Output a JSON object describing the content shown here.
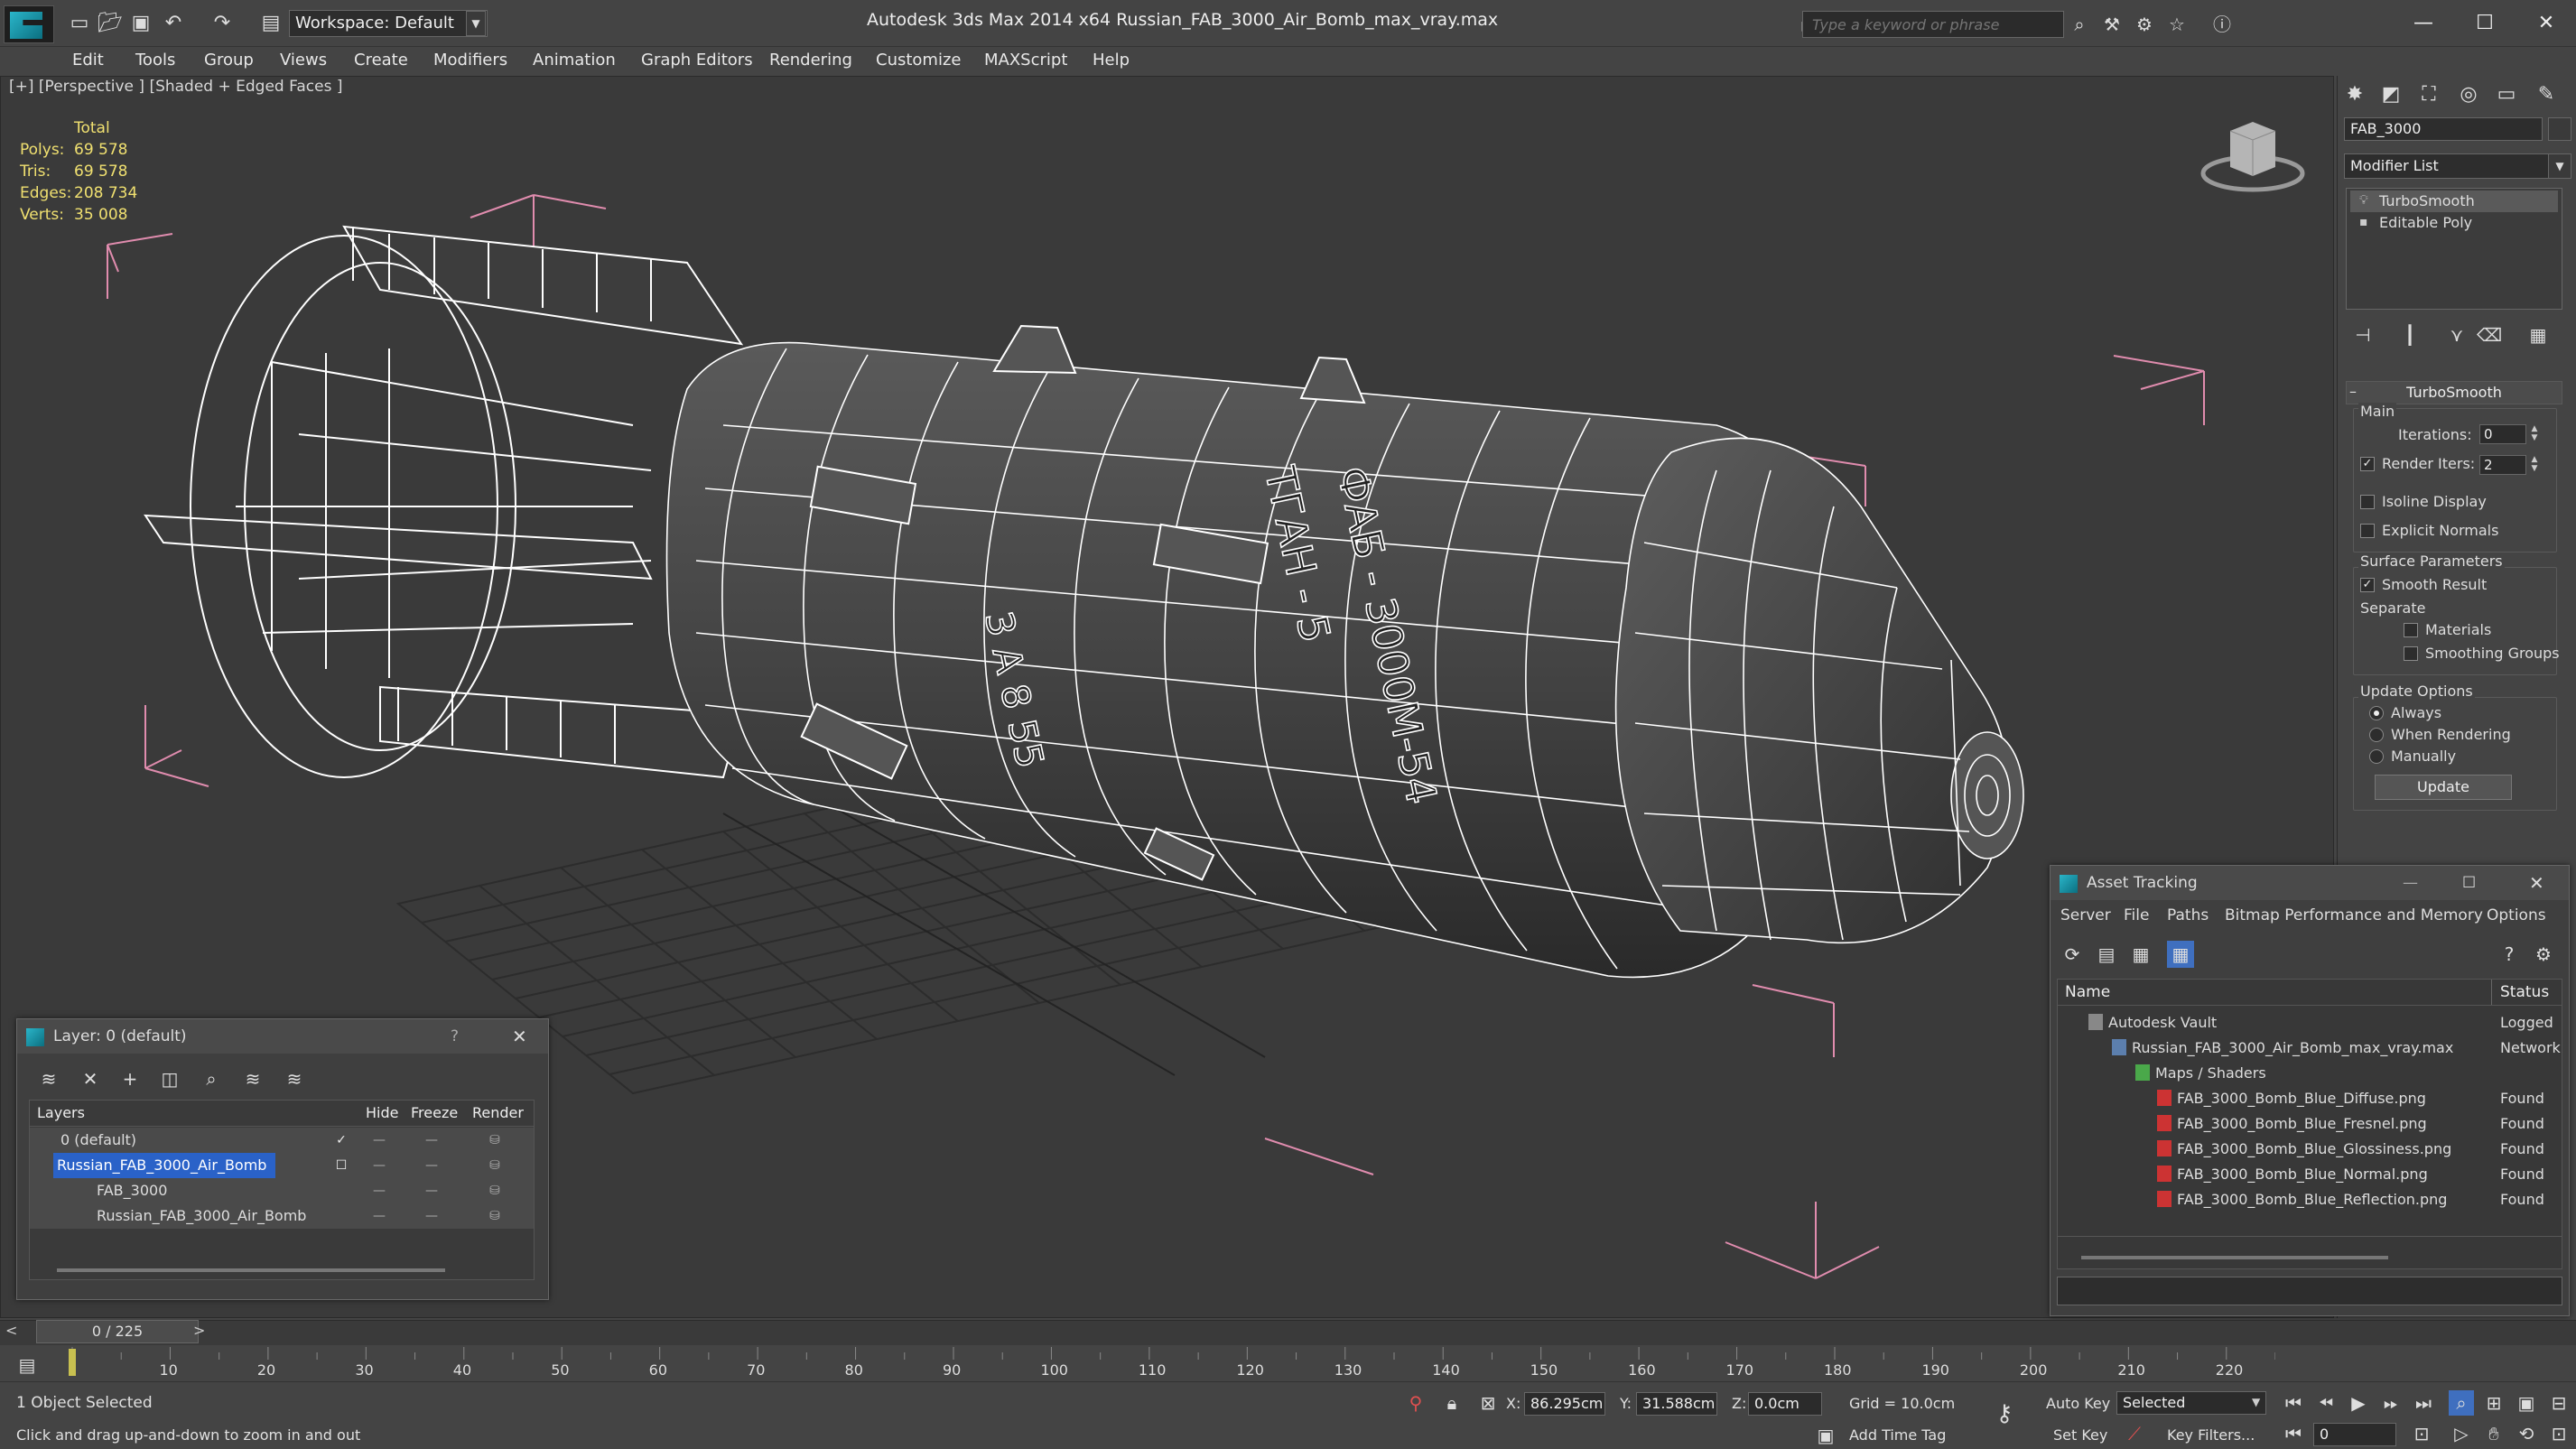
{
  "titlebar": {
    "workspace": "Workspace: Default",
    "app_title": "Autodesk 3ds Max  2014 x64     Russian_FAB_3000_Air_Bomb_max_vray.max",
    "search_placeholder": "Type a keyword or phrase"
  },
  "menu": [
    "Edit",
    "Tools",
    "Group",
    "Views",
    "Create",
    "Modifiers",
    "Animation",
    "Graph Editors",
    "Rendering",
    "Customize",
    "MAXScript",
    "Help"
  ],
  "viewport": {
    "label": "[+] [Perspective ] [Shaded + Edged Faces ]",
    "stats": {
      "header": "Total",
      "rows": [
        {
          "label": "Polys:",
          "value": "69 578"
        },
        {
          "label": "Tris:",
          "value": "69 578"
        },
        {
          "label": "Edges:",
          "value": "208 734"
        },
        {
          "label": "Verts:",
          "value": "35 008"
        }
      ]
    },
    "model_text": [
      "ФАБ - 3000М-54",
      "ТГАН - 5",
      "3 А 8 55"
    ]
  },
  "command_panel": {
    "object_name": "FAB_3000",
    "modifier_list": "Modifier List",
    "stack": [
      "TurboSmooth",
      "Editable Poly"
    ],
    "rollout": "TurboSmooth",
    "main_label": "Main",
    "iterations_label": "Iterations:",
    "iterations": "0",
    "render_iters_label": "Render Iters:",
    "render_iters": "2",
    "isoline": "Isoline Display",
    "explicit": "Explicit Normals",
    "surface_label": "Surface Parameters",
    "smooth_result": "Smooth Result",
    "separate_label": "Separate",
    "materials": "Materials",
    "smoothing_groups": "Smoothing Groups",
    "update_label": "Update Options",
    "always": "Always",
    "when_rendering": "When Rendering",
    "manually": "Manually",
    "update_button": "Update"
  },
  "layer_window": {
    "title": "Layer: 0 (default)",
    "help": "?",
    "columns": [
      "Layers",
      "Hide",
      "Freeze",
      "Render"
    ],
    "rows": [
      {
        "name": "0 (default)"
      },
      {
        "name": "Russian_FAB_3000_Air_Bomb"
      },
      {
        "name": "FAB_3000"
      },
      {
        "name": "Russian_FAB_3000_Air_Bomb"
      }
    ]
  },
  "asset_window": {
    "title": "Asset Tracking",
    "menu": [
      "Server",
      "File",
      "Paths",
      "Bitmap Performance and Memory",
      "Options"
    ],
    "columns": [
      "Name",
      "Status"
    ],
    "rows": [
      {
        "name": "Autodesk Vault",
        "status": "Logged"
      },
      {
        "name": "Russian_FAB_3000_Air_Bomb_max_vray.max",
        "status": "Network"
      },
      {
        "name": "Maps / Shaders",
        "status": ""
      },
      {
        "name": "FAB_3000_Bomb_Blue_Diffuse.png",
        "status": "Found"
      },
      {
        "name": "FAB_3000_Bomb_Blue_Fresnel.png",
        "status": "Found"
      },
      {
        "name": "FAB_3000_Bomb_Blue_Glossiness.png",
        "status": "Found"
      },
      {
        "name": "FAB_3000_Bomb_Blue_Normal.png",
        "status": "Found"
      },
      {
        "name": "FAB_3000_Bomb_Blue_Reflection.png",
        "status": "Found"
      }
    ]
  },
  "timeline": {
    "slider": "0 / 225",
    "ticks": [
      "10",
      "20",
      "30",
      "40",
      "50",
      "60",
      "70",
      "80",
      "90",
      "100",
      "110",
      "120",
      "130",
      "140",
      "150",
      "160",
      "170",
      "180",
      "190",
      "200",
      "210",
      "220"
    ]
  },
  "status": {
    "selected": "1 Object Selected",
    "prompt": "Click and drag up-and-down to zoom in and out",
    "x_label": "X:",
    "x": "86.295cm",
    "y_label": "Y:",
    "y": "31.588cm",
    "z_label": "Z:",
    "z": "0.0cm",
    "grid": "Grid = 10.0cm",
    "auto_key": "Auto Key",
    "key_mode": "Selected",
    "set_key": "Set Key",
    "key_filters": "Key Filters...",
    "add_time_tag": "Add Time Tag",
    "frame": "0"
  }
}
